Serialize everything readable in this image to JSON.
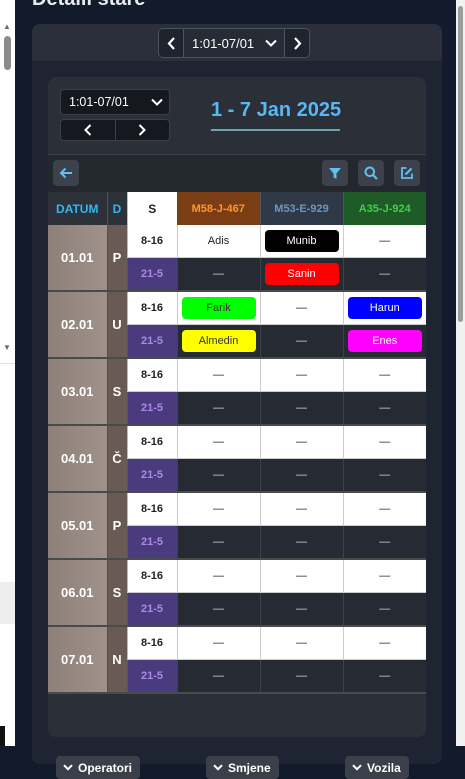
{
  "page": {
    "title": "Detalii stare"
  },
  "top_nav": {
    "prev": "<",
    "range": "1:01-07/01",
    "next": ">"
  },
  "week": {
    "select_value": "1:01-07/01",
    "prev": "<",
    "next": ">",
    "title": "1 - 7 Jan 2025"
  },
  "table": {
    "headers": {
      "datum": "DATUM",
      "day": "D",
      "shift": "S",
      "vehicles": [
        "M58-J-467",
        "M53-E-929",
        "A35-J-924"
      ]
    },
    "days": [
      {
        "date": "01.01",
        "day": "P",
        "shifts": [
          {
            "label": "8-16",
            "cells": [
              {
                "text": "Adis"
              },
              {
                "text": "Munib",
                "bg": "#000000",
                "fg": "#ffffff"
              },
              {
                "text": "—"
              }
            ]
          },
          {
            "label": "21-5",
            "cells": [
              {
                "text": "—"
              },
              {
                "text": "Sanin",
                "bg": "#ff0000",
                "fg": "#ffffff"
              },
              {
                "text": "—"
              }
            ]
          }
        ]
      },
      {
        "date": "02.01",
        "day": "U",
        "shifts": [
          {
            "label": "8-16",
            "cells": [
              {
                "text": "Farik",
                "bg": "#00ff00",
                "fg": "#333333"
              },
              {
                "text": "—"
              },
              {
                "text": "Harun",
                "bg": "#0000ff",
                "fg": "#ffffff"
              }
            ]
          },
          {
            "label": "21-5",
            "cells": [
              {
                "text": "Almedin",
                "bg": "#ffff00",
                "fg": "#333333"
              },
              {
                "text": "—"
              },
              {
                "text": "Enes",
                "bg": "#ff00ff",
                "fg": "#ffffff"
              }
            ]
          }
        ]
      },
      {
        "date": "03.01",
        "day": "S",
        "shifts": [
          {
            "label": "8-16",
            "cells": [
              {
                "text": "—"
              },
              {
                "text": "—"
              },
              {
                "text": "—"
              }
            ]
          },
          {
            "label": "21-5",
            "cells": [
              {
                "text": "—"
              },
              {
                "text": "—"
              },
              {
                "text": "—"
              }
            ]
          }
        ]
      },
      {
        "date": "04.01",
        "day": "Č",
        "shifts": [
          {
            "label": "8-16",
            "cells": [
              {
                "text": "—"
              },
              {
                "text": "—"
              },
              {
                "text": "—"
              }
            ]
          },
          {
            "label": "21-5",
            "cells": [
              {
                "text": "—"
              },
              {
                "text": "—"
              },
              {
                "text": "—"
              }
            ]
          }
        ]
      },
      {
        "date": "05.01",
        "day": "P",
        "shifts": [
          {
            "label": "8-16",
            "cells": [
              {
                "text": "—"
              },
              {
                "text": "—"
              },
              {
                "text": "—"
              }
            ]
          },
          {
            "label": "21-5",
            "cells": [
              {
                "text": "—"
              },
              {
                "text": "—"
              },
              {
                "text": "—"
              }
            ]
          }
        ]
      },
      {
        "date": "06.01",
        "day": "S",
        "shifts": [
          {
            "label": "8-16",
            "cells": [
              {
                "text": "—"
              },
              {
                "text": "—"
              },
              {
                "text": "—"
              }
            ]
          },
          {
            "label": "21-5",
            "cells": [
              {
                "text": "—"
              },
              {
                "text": "—"
              },
              {
                "text": "—"
              }
            ]
          }
        ]
      },
      {
        "date": "07.01",
        "day": "N",
        "shifts": [
          {
            "label": "8-16",
            "cells": [
              {
                "text": "—"
              },
              {
                "text": "—"
              },
              {
                "text": "—"
              }
            ]
          },
          {
            "label": "21-5",
            "cells": [
              {
                "text": "—"
              },
              {
                "text": "—"
              },
              {
                "text": "—"
              }
            ]
          }
        ]
      }
    ]
  },
  "bottom": {
    "operators": "Operatori",
    "shifts": "Smjene",
    "vehicles": "Vozila"
  },
  "icons": {
    "back": "arrow-left-icon",
    "filter": "filter-icon",
    "search": "search-icon",
    "edit": "edit-icon",
    "chevron": "chevron-down-icon"
  },
  "colors": {
    "accent": "#57b8f2"
  }
}
